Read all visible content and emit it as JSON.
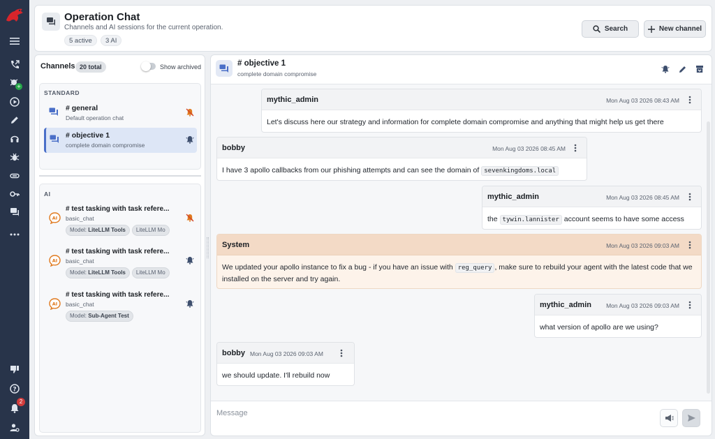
{
  "header": {
    "title": "Operation Chat",
    "subtitle": "Channels and AI sessions for the current operation.",
    "chips": [
      "5 active",
      "3 AI"
    ],
    "search_label": "Search",
    "new_channel_label": "New channel"
  },
  "rail": {
    "notification_count": "2"
  },
  "channels": {
    "title": "Channels",
    "total_badge": "20 total",
    "show_archived_label": "Show archived",
    "standard_label": "STANDARD",
    "ai_label": "AI",
    "standard": [
      {
        "name": "# general",
        "description": "Default operation chat"
      },
      {
        "name": "# objective 1",
        "description": "complete domain compromise"
      }
    ],
    "ai": [
      {
        "name": "# test tasking with task refere...",
        "description": "basic_chat",
        "tags": [
          {
            "key": "Model:",
            "value": "LiteLLM Tools"
          },
          {
            "key": "LiteLLM Mo",
            "value": ""
          }
        ]
      },
      {
        "name": "# test tasking with task refere...",
        "description": "basic_chat",
        "tags": [
          {
            "key": "Model:",
            "value": "LiteLLM Tools"
          },
          {
            "key": "LiteLLM Mo",
            "value": ""
          }
        ]
      },
      {
        "name": "# test tasking with task refere...",
        "description": "basic_chat",
        "tags": [
          {
            "key": "Model:",
            "value": "Sub-Agent Test"
          }
        ]
      }
    ]
  },
  "chat": {
    "title": "# objective 1",
    "subtitle": "complete domain compromise",
    "composer_placeholder": "Message",
    "messages": [
      {
        "author": "mythic_admin",
        "time": "Mon Aug 03 2026 08:43 AM",
        "text": "Let's discuss here our strategy and information for complete domain compromise and anything that might help us get there"
      },
      {
        "author": "bobby",
        "time": "Mon Aug 03 2026 08:45 AM",
        "text_before": "I have 3 apollo callbacks from our phishing attempts and can see the domain of",
        "code": "sevenkingdoms.local"
      },
      {
        "author": "mythic_admin",
        "time": "Mon Aug 03 2026 08:45 AM",
        "text_prefix": "the",
        "code": "tywin.lannister",
        "text_after": "account seems to have some access"
      },
      {
        "author": "System",
        "time": "Mon Aug 03 2026 09:03 AM",
        "text_before": "We updated your apollo instance to fix a bug - if you have an issue with",
        "code": "reg_query",
        "text_after": ", make sure to rebuild your agent with the latest code that we installed on the server and try again."
      },
      {
        "author": "mythic_admin",
        "time": "Mon Aug 03 2026 09:03 AM",
        "text": "what version of apollo are we using?"
      },
      {
        "author": "bobby",
        "time": "Mon Aug 03 2026 09:03 AM",
        "text": "we should update. I'll rebuild now"
      }
    ]
  }
}
